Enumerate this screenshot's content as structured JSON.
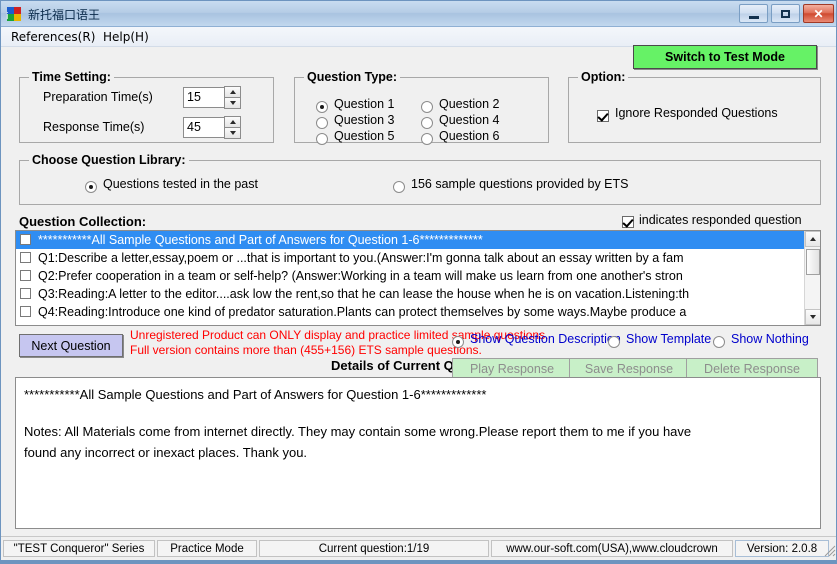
{
  "window": {
    "title": "新托福口语王",
    "icon": "app-icon",
    "buttons": {
      "minimize": "minimize-icon",
      "maximize": "maximize-icon",
      "close": "close-icon"
    }
  },
  "menu": {
    "items": [
      {
        "label": "References(R)"
      },
      {
        "label": "Help(H)"
      }
    ]
  },
  "switch_mode_button": "Switch to Test Mode",
  "time_setting": {
    "legend": "Time Setting:",
    "preparation_label": "Preparation Time(s)",
    "preparation_value": "15",
    "response_label": "Response Time(s)",
    "response_value": "45"
  },
  "question_type": {
    "legend": "Question Type:",
    "options": [
      {
        "label": "Question 1",
        "checked": true
      },
      {
        "label": "Question 2",
        "checked": false
      },
      {
        "label": "Question 3",
        "checked": false
      },
      {
        "label": "Question 4",
        "checked": false
      },
      {
        "label": "Question 5",
        "checked": false
      },
      {
        "label": "Question 6",
        "checked": false
      }
    ]
  },
  "option": {
    "legend": "Option:",
    "ignore_responded_label": "Ignore Responded Questions",
    "ignore_responded_checked": true
  },
  "question_library": {
    "legend": "Choose Question Library:",
    "options": [
      {
        "label": "Questions tested in the past",
        "checked": true
      },
      {
        "label": "156 sample questions provided by ETS",
        "checked": false
      }
    ]
  },
  "question_collection": {
    "title": "Question Collection:",
    "responded_hint": "indicates responded question",
    "responded_hint_checked": true,
    "rows": [
      {
        "text": "***********All Sample Questions and Part of Answers for Question 1-6*************",
        "selected": true,
        "checked": false
      },
      {
        "text": "Q1:Describe a letter,essay,poem or ...that is important to you.(Answer:I'm gonna talk about an essay written by a fam",
        "selected": false,
        "checked": false
      },
      {
        "text": "Q2:Prefer cooperation in a team or self-help? (Answer:Working in a team will make us learn from one another's stron",
        "selected": false,
        "checked": false
      },
      {
        "text": "Q3:Reading:A letter to the editor....ask low the rent,so that he can lease the house when he is on vacation.Listening:th",
        "selected": false,
        "checked": false
      },
      {
        "text": "Q4:Reading:Introduce one kind of predator saturation.Plants can protect themselves by some ways.Maybe produce a",
        "selected": false,
        "checked": false
      }
    ]
  },
  "next_question_button": "Next Question",
  "warning": {
    "line1": "Unregistered Product can ONLY display and practice limited sample questions.",
    "line2": "Full version contains more than (455+156) ETS sample questions."
  },
  "display_mode": {
    "options": [
      {
        "label": "Show Question Description",
        "checked": true
      },
      {
        "label": "Show Template",
        "checked": false
      },
      {
        "label": "Show Nothing",
        "checked": false
      }
    ]
  },
  "details_label": "Details of Current Question:",
  "response_buttons": [
    {
      "label": "Play Response",
      "enabled": false
    },
    {
      "label": "Save Response",
      "enabled": false
    },
    {
      "label": "Delete Response",
      "enabled": false
    }
  ],
  "details_text": {
    "heading": "***********All Sample Questions and Part of Answers for Question 1-6*************",
    "body_line1": "Notes: All Materials come from internet directly. They may contain some wrong.Please report them to me if you have",
    "body_line2": "found any incorrect or inexact places. Thank you."
  },
  "statusbar": {
    "cells": [
      "\"TEST Conqueror\" Series",
      "Practice Mode",
      "Current question:1/19",
      "www.our-soft.com(USA),www.cloudcrown",
      "Version: 2.0.8"
    ]
  },
  "colors": {
    "accent_green": "#66f266",
    "selection_blue": "#2f8df2",
    "warning_red": "#ff0000",
    "link_blue": "#0000cc"
  }
}
